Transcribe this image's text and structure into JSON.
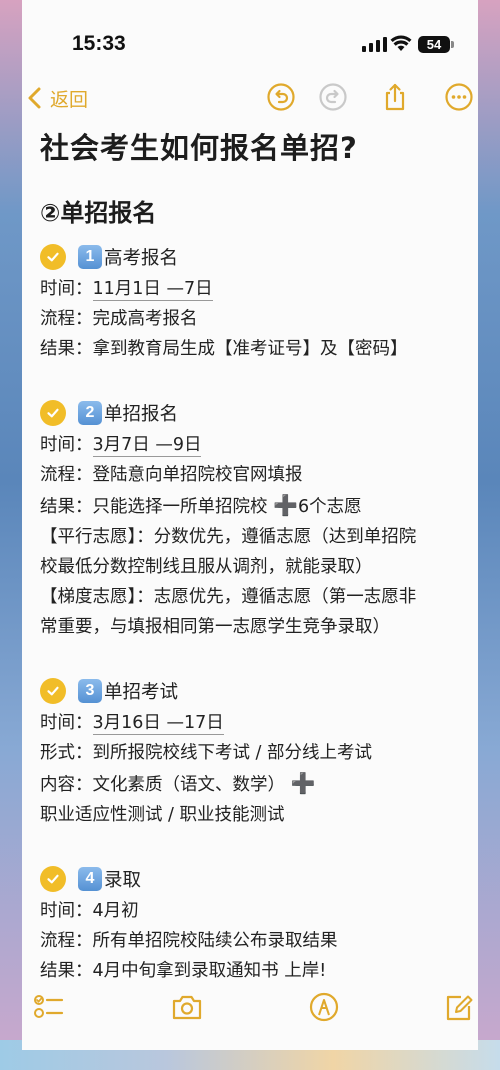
{
  "status_bar": {
    "time": "15:33",
    "battery": "54"
  },
  "nav": {
    "back_label": "返回",
    "icons": [
      "undo-icon",
      "redo-icon",
      "share-icon",
      "more-icon"
    ]
  },
  "note": {
    "title": "社会考生如何报名单招?",
    "section_heading": "②单招报名",
    "steps": [
      {
        "num": "1",
        "title": "高考报名",
        "lines": [
          {
            "label": "时间：",
            "value": "11月1日 —7日"
          },
          {
            "label": "流程：",
            "value": "完成高考报名"
          },
          {
            "label": "结果：",
            "value": "拿到教育局生成【准考证号】及【密码】"
          }
        ]
      },
      {
        "num": "2",
        "title": "单招报名",
        "lines": [
          {
            "label": "时间：",
            "value": "3月7日 —9日"
          },
          {
            "label": "流程：",
            "value": "登陆意向单招院校官网填报"
          },
          {
            "label": "结果：",
            "value": "只能选择一所单招院校",
            "plus": "➕",
            "value_after": "6个志愿"
          }
        ],
        "extra_lines": [
          "【平行志愿】：分数优先，遵循志愿（达到单招院",
          "校最低分数控制线且服从调剂，就能录取）",
          "【梯度志愿】：志愿优先，遵循志愿（第一志愿非",
          "常重要，与填报相同第一志愿学生竞争录取）"
        ]
      },
      {
        "num": "3",
        "title": "单招考试",
        "lines": [
          {
            "label": "时间：",
            "value": "3月16日 —17日"
          },
          {
            "label": "形式：",
            "value": "到所报院校线下考试 / 部分线上考试"
          },
          {
            "label": "内容：",
            "value": "文化素质（语文、数学）",
            "plus": "➕"
          }
        ],
        "extra_lines": [
          "职业适应性测试 / 职业技能测试"
        ]
      },
      {
        "num": "4",
        "title": "录取",
        "lines": [
          {
            "label": "时间：",
            "value": "4月初"
          },
          {
            "label": "流程：",
            "value": "所有单招院校陆续公布录取结果"
          },
          {
            "label": "结果：",
            "value": "4月中旬拿到录取通知书 上岸!"
          }
        ]
      }
    ]
  },
  "toolbar": {
    "icons": [
      "checklist-icon",
      "camera-icon",
      "markup-pen-icon",
      "compose-icon"
    ]
  },
  "colors": {
    "accent": "#e0a92c",
    "check": "#f1bd28",
    "number_box": "#5591d3"
  }
}
